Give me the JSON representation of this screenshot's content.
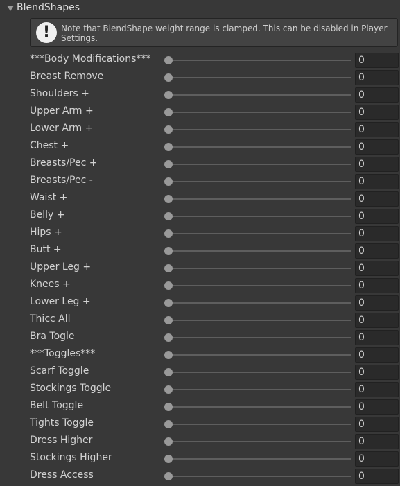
{
  "foldout": {
    "label": "BlendShapes",
    "expanded": true
  },
  "helpbox": {
    "icon": "info-exclamation-icon",
    "text": "Note that BlendShape weight range is clamped. This can be disabled in Player Settings."
  },
  "blendshapes": [
    {
      "label": "***Body Modifications***",
      "value": "0"
    },
    {
      "label": "Breast Remove",
      "value": "0"
    },
    {
      "label": "Shoulders +",
      "value": "0"
    },
    {
      "label": "Upper Arm +",
      "value": "0"
    },
    {
      "label": "Lower Arm +",
      "value": "0"
    },
    {
      "label": "Chest +",
      "value": "0"
    },
    {
      "label": "Breasts/Pec +",
      "value": "0"
    },
    {
      "label": "Breasts/Pec -",
      "value": "0"
    },
    {
      "label": "Waist +",
      "value": "0"
    },
    {
      "label": "Belly +",
      "value": "0"
    },
    {
      "label": "Hips +",
      "value": "0"
    },
    {
      "label": "Butt +",
      "value": "0"
    },
    {
      "label": "Upper Leg +",
      "value": "0"
    },
    {
      "label": "Knees +",
      "value": "0"
    },
    {
      "label": "Lower Leg +",
      "value": "0"
    },
    {
      "label": "Thicc All",
      "value": "0"
    },
    {
      "label": "Bra Togle",
      "value": "0"
    },
    {
      "label": "***Toggles***",
      "value": "0"
    },
    {
      "label": "Scarf Toggle",
      "value": "0"
    },
    {
      "label": "Stockings Toggle",
      "value": "0"
    },
    {
      "label": "Belt Toggle",
      "value": "0"
    },
    {
      "label": "Tights Toggle",
      "value": "0"
    },
    {
      "label": "Dress Higher",
      "value": "0"
    },
    {
      "label": "Stockings Higher",
      "value": "0"
    },
    {
      "label": "Dress Access",
      "value": "0"
    }
  ],
  "colors": {
    "background": "#383838",
    "field": "#2a2a2a",
    "thumb": "#999999",
    "track": "#5e5e5e",
    "text": "#d2d2d2"
  }
}
